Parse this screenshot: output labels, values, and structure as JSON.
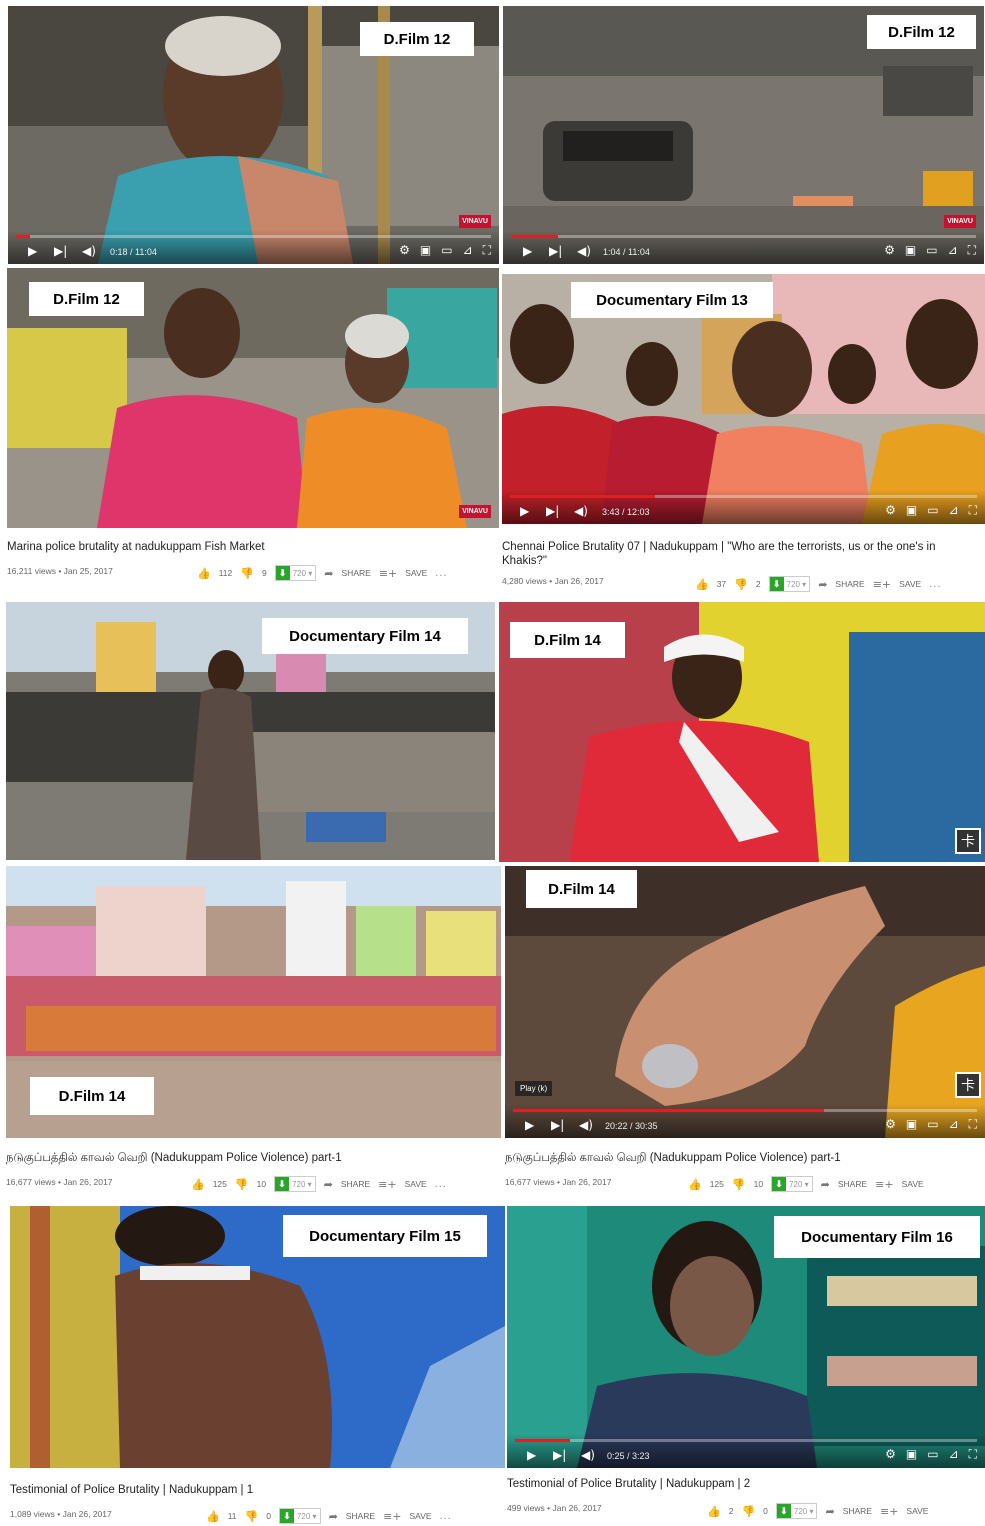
{
  "tags": {
    "t1": "D.Film 12",
    "t2": "D.Film 12",
    "t3": "D.Film 12",
    "t4": "Documentary Film 13",
    "t5": "Documentary Film 14",
    "t6": "D.Film 14",
    "t7": "D.Film 14",
    "t8": "D.Film 14",
    "t9": "Documentary Film 15",
    "t10": "Documentary Film 16"
  },
  "players": {
    "p1": {
      "time": "0:18 / 11:04",
      "progress": 0.03,
      "brand": "VINAVU"
    },
    "p2": {
      "time": "1:04 / 11:04",
      "progress": 0.1,
      "brand": "VINAVU"
    },
    "p3": {
      "brand": "VINAVU"
    },
    "p4": {
      "time": "3:43 / 12:03",
      "progress": 0.31
    },
    "p8": {
      "time": "20:22 / 30:35",
      "progress": 0.67,
      "hint": "Play (k)"
    },
    "p10": {
      "time": "0:25 / 3:23",
      "progress": 0.12
    }
  },
  "icons": {
    "play": "▶",
    "next": "▶|",
    "volume": "◀)",
    "settings": "⚙",
    "miniplayer": "▣",
    "theater": "▭",
    "cast": "⊿",
    "fullscreen": "⛶",
    "like": "👍",
    "dislike": "👎",
    "share": "➦",
    "save": "≡+",
    "more": "..."
  },
  "videos": {
    "v1": {
      "title": "Marina police brutality at nadukuppam Fish Market",
      "views": "16,211 views • Jan 25, 2017",
      "likes": "112",
      "dislikes": "9",
      "quality": "720 ▾",
      "share": "SHARE",
      "save": "SAVE"
    },
    "v2": {
      "title": "Chennai Police Brutality 07 | Nadukuppam | \"Who are the terrorists, us or the one's in Khakis?\"",
      "views": "4,280 views • Jan 26, 2017",
      "likes": "37",
      "dislikes": "2",
      "quality": "720 ▾",
      "share": "SHARE",
      "save": "SAVE"
    },
    "v3": {
      "title": "நடுகுப்பத்தில் காவல் வெறி (Nadukuppam Police Violence) part-1",
      "views": "16,677 views • Jan 26, 2017",
      "likes": "125",
      "dislikes": "10",
      "quality": "720 ▾",
      "share": "SHARE",
      "save": "SAVE"
    },
    "v4": {
      "title": "நடுகுப்பத்தில் காவல் வெறி (Nadukuppam Police Violence) part-1",
      "views": "16,677 views • Jan 26, 2017",
      "likes": "125",
      "dislikes": "10",
      "quality": "720 ▾",
      "share": "SHARE",
      "save": "SAVE"
    },
    "v5": {
      "title": "Testimonial of Police Brutality | Nadukuppam | 1",
      "views": "1,089 views • Jan 26, 2017",
      "likes": "11",
      "dislikes": "0",
      "quality": "720 ▾",
      "share": "SHARE",
      "save": "SAVE"
    },
    "v6": {
      "title": "Testimonial of Police Brutality | Nadukuppam | 2",
      "views": "499 views • Jan 26, 2017",
      "likes": "2",
      "dislikes": "0",
      "quality": "720 ▾",
      "share": "SHARE",
      "save": "SAVE"
    }
  },
  "colors": {
    "accent": "#e02020",
    "download": "#2aa52a",
    "brand": "#c4122f"
  }
}
